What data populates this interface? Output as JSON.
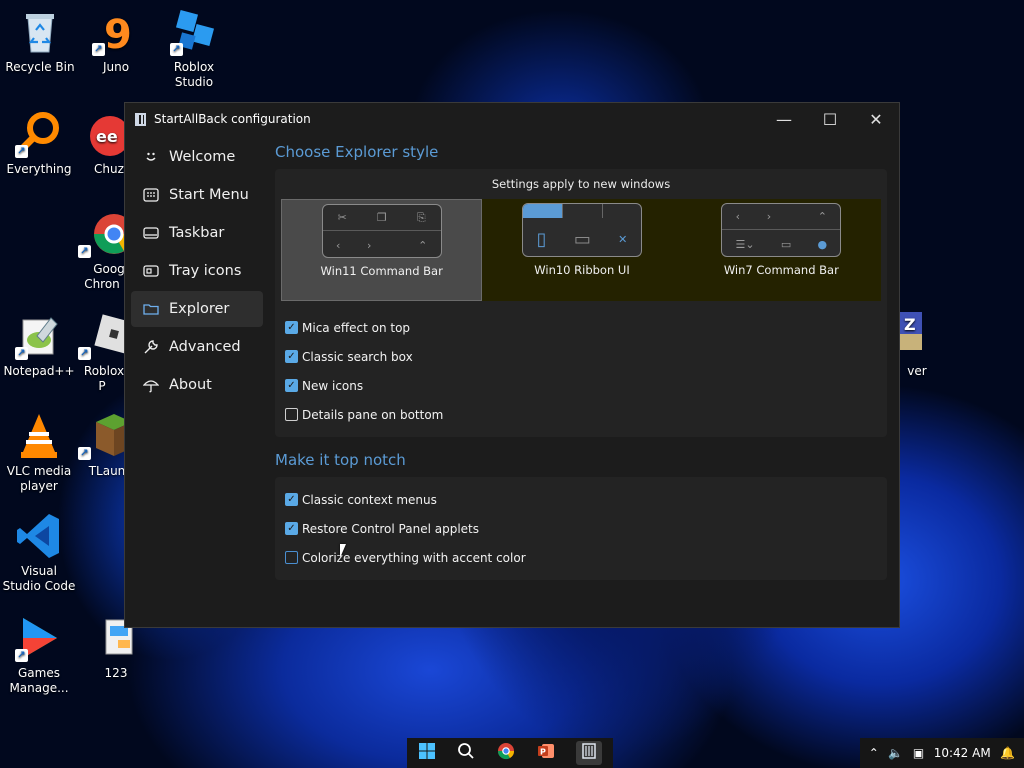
{
  "desktop": {
    "icons": [
      {
        "label": "Recycle Bin",
        "icon": "recycle-bin-icon"
      },
      {
        "label": "Juno",
        "icon": "juno-icon"
      },
      {
        "label": "Roblox Studio",
        "icon": "roblox-studio-icon"
      },
      {
        "label": "Everything",
        "icon": "everything-search-icon"
      },
      {
        "label": "Chuz",
        "icon": "chuz-icon"
      },
      {
        "label": "Goog Chron",
        "icon": "chrome-icon"
      },
      {
        "label": "Notepad++",
        "icon": "notepad-plus-plus-icon"
      },
      {
        "label": "Roblox P",
        "icon": "roblox-player-icon"
      },
      {
        "label": "ver",
        "icon": "app-icon"
      },
      {
        "label": "VLC media player",
        "icon": "vlc-icon"
      },
      {
        "label": "TLaun",
        "icon": "tlauncher-icon"
      },
      {
        "label": "Visual Studio Code",
        "icon": "vscode-icon"
      },
      {
        "label": "Games Manage...",
        "icon": "games-manager-icon"
      },
      {
        "label": "123",
        "icon": "file-icon"
      }
    ]
  },
  "window": {
    "title": "StartAllBack configuration",
    "controls": {
      "minimize": "—",
      "maximize": "☐",
      "close": "✕"
    },
    "nav": [
      {
        "label": "Welcome",
        "icon": "smile-icon"
      },
      {
        "label": "Start Menu",
        "icon": "start-menu-icon"
      },
      {
        "label": "Taskbar",
        "icon": "taskbar-icon"
      },
      {
        "label": "Tray icons",
        "icon": "tray-icon"
      },
      {
        "label": "Explorer",
        "icon": "folder-icon"
      },
      {
        "label": "Advanced",
        "icon": "wrench-icon"
      },
      {
        "label": "About",
        "icon": "umbrella-icon"
      }
    ],
    "active_nav": "Explorer",
    "explorer_style": {
      "title": "Choose Explorer style",
      "subtitle": "Settings apply to new windows",
      "options": [
        {
          "label": "Win11 Command Bar"
        },
        {
          "label": "Win10 Ribbon UI"
        },
        {
          "label": "Win7 Command Bar"
        }
      ],
      "selected": "Win11 Command Bar",
      "checks": [
        {
          "label": "Mica effect on top",
          "checked": true
        },
        {
          "label": "Classic search box",
          "checked": true
        },
        {
          "label": "New icons",
          "checked": true
        },
        {
          "label": "Details pane on bottom",
          "checked": false
        }
      ]
    },
    "top_notch": {
      "title": "Make it top notch",
      "checks": [
        {
          "label": "Classic context menus",
          "checked": true
        },
        {
          "label": "Restore Control Panel applets",
          "checked": true
        },
        {
          "label": "Colorize everything with accent color",
          "checked": false
        }
      ]
    }
  },
  "taskbar": {
    "apps": [
      "windows-start-icon",
      "search-icon",
      "chrome-icon",
      "powerpoint-icon",
      "startallback-icon"
    ],
    "tray": {
      "time": "10:42 AM",
      "icons": [
        "chevron-up-icon",
        "volume-icon",
        "network-icon",
        "notification-bell-icon"
      ]
    }
  },
  "colors": {
    "accent": "#5b9bd5",
    "checkbox": "#5aa9e6",
    "window_bg": "#1c1c1c"
  }
}
